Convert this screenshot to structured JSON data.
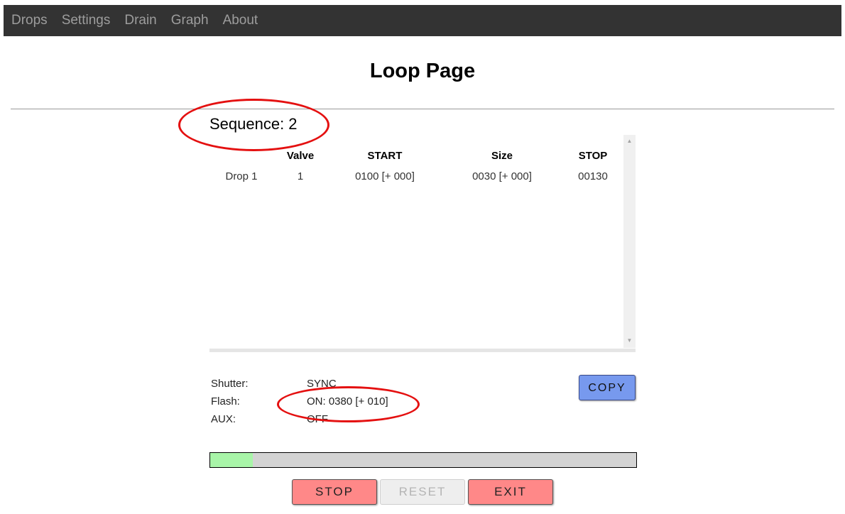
{
  "nav": {
    "items": [
      "Drops",
      "Settings",
      "Drain",
      "Graph",
      "About"
    ]
  },
  "page": {
    "title": "Loop Page"
  },
  "sequence": {
    "label": "Sequence: 2"
  },
  "table": {
    "headers": [
      "",
      "Valve",
      "START",
      "Size",
      "STOP"
    ],
    "rows": [
      [
        "Drop 1",
        "1",
        "0100 [+ 000]",
        "0030 [+ 000]",
        "00130"
      ]
    ]
  },
  "settings": {
    "shutter_label": "Shutter:",
    "shutter_value": "SYNC",
    "flash_label": "Flash:",
    "flash_value": "ON: 0380 [+ 010]",
    "aux_label": "AUX:",
    "aux_value": "OFF"
  },
  "buttons": {
    "copy": "COPY",
    "stop": "STOP",
    "reset": "RESET",
    "exit": "EXIT"
  },
  "progress": {
    "fraction": 0.1
  },
  "colors": {
    "navbar": "#333333",
    "nav_text": "#9d9d9d",
    "copy_button": "#7799ee",
    "stop_exit_button": "#ff8888",
    "progress_fill": "#a8f5a8",
    "annotation": "#e41010"
  }
}
